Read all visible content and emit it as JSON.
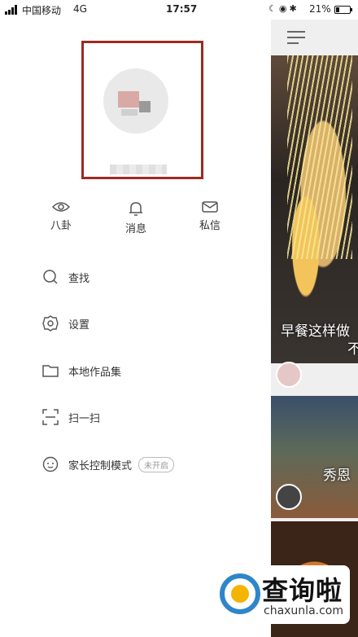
{
  "status_bar": {
    "carrier": "中国移动",
    "network": "4G",
    "time": "17:57",
    "battery": "21%"
  },
  "quick_actions": [
    {
      "label": "八卦"
    },
    {
      "label": "消息"
    },
    {
      "label": "私信"
    }
  ],
  "menu": {
    "search": "查找",
    "settings": "设置",
    "local_works": "本地作品集",
    "scan": "扫一扫",
    "parental": "家长控制模式",
    "parental_status": "未开启"
  },
  "feed": {
    "caption_1": "早餐这样做",
    "caption_1b": "不",
    "caption_2": "秀恩"
  },
  "watermark": {
    "title": "查询啦",
    "url": "chaxunla.com"
  },
  "colors": {
    "highlight": "#9e2a22",
    "watermark_blue": "#2e86c9",
    "watermark_yellow": "#f5b400"
  }
}
